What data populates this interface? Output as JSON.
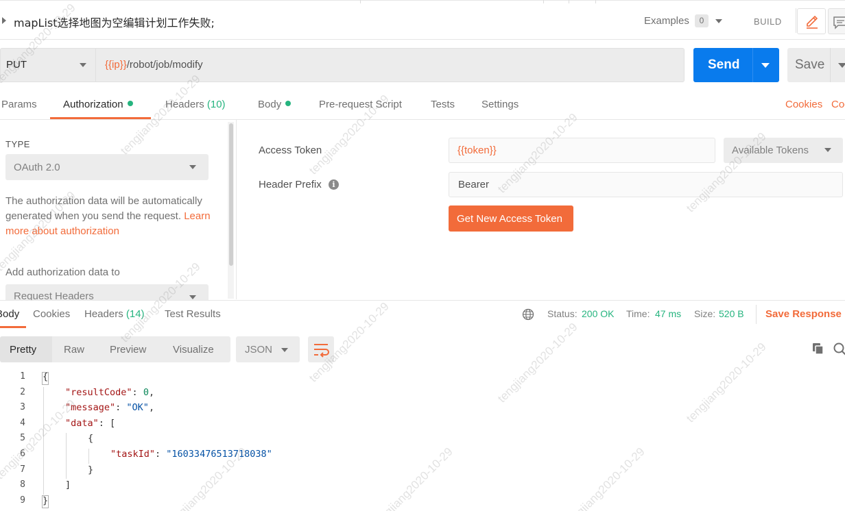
{
  "request": {
    "name": "mapList选择地图为空编辑计划工作失败;",
    "examples_label": "Examples",
    "examples_count": "0",
    "build_label": "BUILD",
    "method": "PUT",
    "url_var": "{{ip}}",
    "url_path": "/robot/job/modify",
    "send_label": "Send",
    "save_label": "Save"
  },
  "req_tabs": [
    {
      "label": "Params"
    },
    {
      "label": "Authorization"
    },
    {
      "label": "Headers",
      "count": "(10)"
    },
    {
      "label": "Body"
    },
    {
      "label": "Pre-request Script"
    },
    {
      "label": "Tests"
    },
    {
      "label": "Settings"
    }
  ],
  "req_links": {
    "cookies": "Cookies",
    "code": "Code"
  },
  "auth": {
    "type_label": "TYPE",
    "type_value": "OAuth 2.0",
    "desc_text": "The authorization data will be automatically generated when you send the request. ",
    "desc_link": "Learn more about authorization",
    "add_to_label": "Add authorization data to",
    "add_to_value": "Request Headers",
    "access_token_label": "Access Token",
    "access_token_value": "{{token}}",
    "available_tokens": "Available Tokens",
    "header_prefix_label": "Header Prefix",
    "header_prefix_value": "Bearer",
    "new_token_button": "Get New Access Token"
  },
  "resp_tabs": [
    {
      "label": "Body"
    },
    {
      "label": "Cookies"
    },
    {
      "label": "Headers",
      "count": "(14)"
    },
    {
      "label": "Test Results"
    }
  ],
  "resp_meta": {
    "status_label": "Status:",
    "status_value": "200 OK",
    "time_label": "Time:",
    "time_value": "47 ms",
    "size_label": "Size:",
    "size_value": "520 B",
    "save_response": "Save Response"
  },
  "formats": [
    "Pretty",
    "Raw",
    "Preview",
    "Visualize"
  ],
  "lang": "JSON",
  "code_lines": [
    {
      "n": "1",
      "text": "{"
    },
    {
      "n": "2",
      "key": "\"resultCode\"",
      "rest": ": ",
      "num": "0",
      "tail": ","
    },
    {
      "n": "3",
      "key": "\"message\"",
      "rest": ": ",
      "str": "\"OK\"",
      "tail": ","
    },
    {
      "n": "4",
      "key": "\"data\"",
      "rest": ": ["
    },
    {
      "n": "5",
      "text": "{"
    },
    {
      "n": "6",
      "key": "\"taskId\"",
      "rest": ": ",
      "str": "\"16033476513718038\""
    },
    {
      "n": "7",
      "text": "}"
    },
    {
      "n": "8",
      "text": "]"
    },
    {
      "n": "9",
      "text": "}"
    }
  ],
  "watermark": "tengjiang2020-10-29",
  "colors": {
    "accent": "#f26b3a",
    "send": "#097bed",
    "success": "#26b47f"
  }
}
